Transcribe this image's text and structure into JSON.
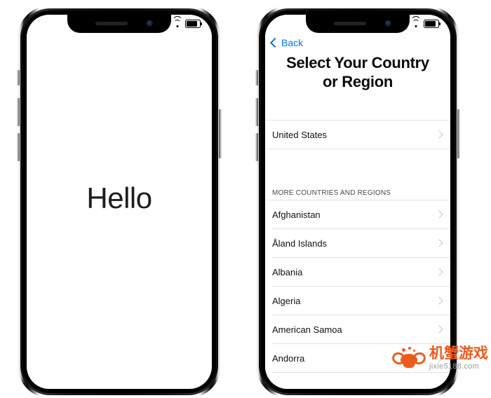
{
  "page": {
    "description": "Two iPhone X devices side by side showing iOS setup: Hello screen and Select Your Country or Region screen"
  },
  "status_bar": {
    "cellular_icon": "cellular-bars-icon",
    "wifi_icon": "wifi-icon",
    "battery_icon": "battery-icon"
  },
  "phone_left": {
    "name": "hello-screen",
    "greeting": "Hello"
  },
  "phone_right": {
    "name": "country-selection-screen",
    "nav": {
      "back_label": "Back",
      "back_icon": "chevron-left-icon"
    },
    "title": "Select Your Country or Region",
    "title_line1": "Select Your Country",
    "title_line2": "or Region",
    "primary_row": {
      "label": "United States",
      "chevron_icon": "chevron-right-icon"
    },
    "section_header": "MORE COUNTRIES AND REGIONS",
    "countries": [
      {
        "label": "Afghanistan"
      },
      {
        "label": "Åland Islands"
      },
      {
        "label": "Albania"
      },
      {
        "label": "Algeria"
      },
      {
        "label": "American Samoa"
      },
      {
        "label": "Andorra"
      }
    ]
  },
  "watermark": {
    "brand_cn": "机蟹游戏",
    "url": "jixie5188.com",
    "logo_icon": "crab-logo-icon",
    "color": "#ec5b1e"
  },
  "colors": {
    "accent_blue": "#0a72e8",
    "text_primary": "#111111",
    "separator": "#e3e3e3",
    "chevron_gray": "#c3c3c7",
    "watermark_orange": "#ec5b1e"
  }
}
